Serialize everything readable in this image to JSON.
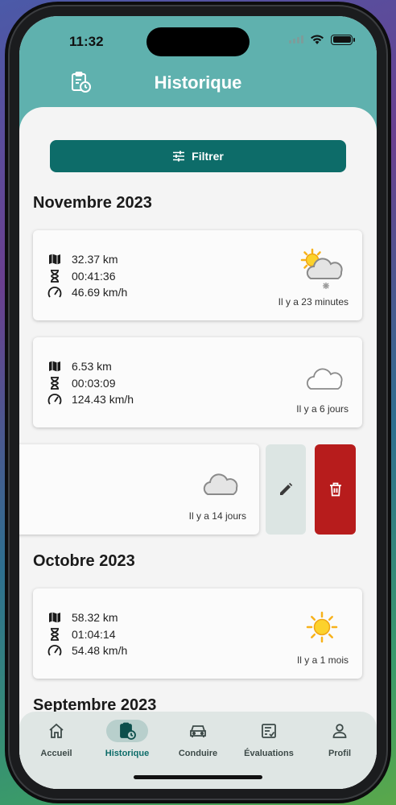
{
  "status_bar": {
    "time": "11:32"
  },
  "header": {
    "title": "Historique",
    "icon": "clipboard-clock-icon"
  },
  "filter_button": {
    "label": "Filtrer",
    "icon": "tune-icon"
  },
  "sections": [
    {
      "month": "Novembre 2023",
      "trips": [
        {
          "distance": "32.37 km",
          "duration": "00:41:36",
          "speed": "46.69 km/h",
          "weather": "sun-cloud-snow-icon",
          "ago": "Il y a 23 minutes"
        },
        {
          "distance": "6.53 km",
          "duration": "00:03:09",
          "speed": "124.43 km/h",
          "weather": "moon-cloud-icon",
          "ago": "Il y a 6 jours"
        },
        {
          "distance": "",
          "duration": "",
          "speed": "",
          "weather": "cloud-icon",
          "ago": "Il y a 14 jours",
          "swiped": true,
          "actions": [
            "edit-icon",
            "delete-icon"
          ]
        }
      ]
    },
    {
      "month": "Octobre 2023",
      "trips": [
        {
          "distance": "58.32 km",
          "duration": "01:04:14",
          "speed": "54.48 km/h",
          "weather": "sun-icon",
          "ago": "Il y a 1 mois"
        }
      ]
    },
    {
      "month": "Septembre 2023",
      "trips": []
    }
  ],
  "bottom_nav": [
    {
      "label": "Accueil",
      "icon": "home-icon",
      "active": false
    },
    {
      "label": "Historique",
      "icon": "clipboard-clock-icon",
      "active": true
    },
    {
      "label": "Conduire",
      "icon": "car-icon",
      "active": false
    },
    {
      "label": "Évaluations",
      "icon": "checklist-icon",
      "active": false
    },
    {
      "label": "Profil",
      "icon": "person-icon",
      "active": false
    }
  ],
  "colors": {
    "primary": "#0d6c69",
    "header": "#5fb1ae",
    "danger": "#b71c1c",
    "edit_bg": "#dce5e3"
  }
}
